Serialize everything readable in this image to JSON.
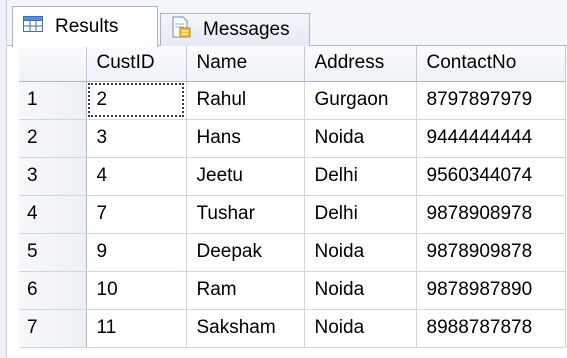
{
  "tabs": {
    "results": {
      "label": "Results",
      "icon": "grid-icon"
    },
    "messages": {
      "label": "Messages",
      "icon": "messages-icon"
    }
  },
  "grid": {
    "columns": [
      "",
      "CustID",
      "Name",
      "Address",
      "ContactNo"
    ],
    "rows": [
      {
        "row": "1",
        "CustID": "2",
        "Name": "Rahul",
        "Address": "Gurgaon",
        "ContactNo": "8797897979"
      },
      {
        "row": "2",
        "CustID": "3",
        "Name": "Hans",
        "Address": "Noida",
        "ContactNo": "9444444444"
      },
      {
        "row": "3",
        "CustID": "4",
        "Name": "Jeetu",
        "Address": "Delhi",
        "ContactNo": "9560344074"
      },
      {
        "row": "4",
        "CustID": "7",
        "Name": "Tushar",
        "Address": "Delhi",
        "ContactNo": "9878908978"
      },
      {
        "row": "5",
        "CustID": "9",
        "Name": "Deepak",
        "Address": "Noida",
        "ContactNo": "9878909878"
      },
      {
        "row": "6",
        "CustID": "10",
        "Name": "Ram",
        "Address": "Noida",
        "ContactNo": "9878987890"
      },
      {
        "row": "7",
        "CustID": "11",
        "Name": "Saksham",
        "Address": "Noida",
        "ContactNo": "8988787878"
      }
    ]
  },
  "colors": {
    "grid_line": "#cfd6e1",
    "header_bg": "#eef1f6",
    "tab_border": "#a9b6c8"
  }
}
